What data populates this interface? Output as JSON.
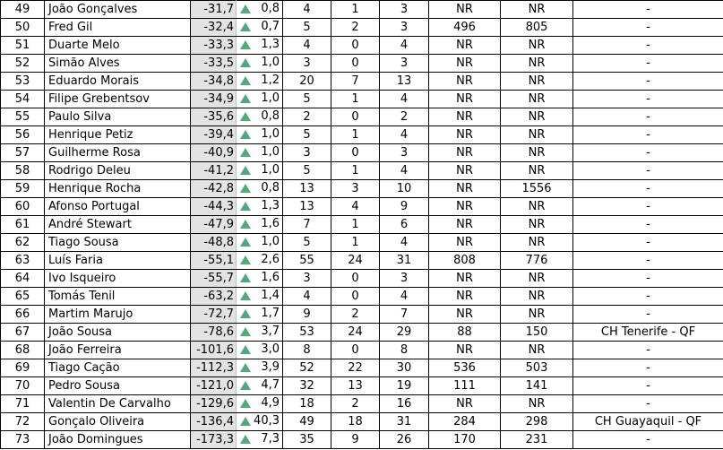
{
  "rows": [
    {
      "rank": "49",
      "name": "João Gonçalves",
      "score": "-31,7",
      "ratio": "0,8",
      "a": "4",
      "b": "1",
      "c": "3",
      "d": "NR",
      "e": "NR",
      "note": "-"
    },
    {
      "rank": "50",
      "name": "Fred Gil",
      "score": "-32,4",
      "ratio": "0,7",
      "a": "5",
      "b": "2",
      "c": "3",
      "d": "496",
      "e": "805",
      "note": "-"
    },
    {
      "rank": "51",
      "name": "Duarte Melo",
      "score": "-33,3",
      "ratio": "1,3",
      "a": "4",
      "b": "0",
      "c": "4",
      "d": "NR",
      "e": "NR",
      "note": "-"
    },
    {
      "rank": "52",
      "name": "Simão Alves",
      "score": "-33,5",
      "ratio": "1,0",
      "a": "3",
      "b": "0",
      "c": "3",
      "d": "NR",
      "e": "NR",
      "note": "-"
    },
    {
      "rank": "53",
      "name": "Eduardo Morais",
      "score": "-34,8",
      "ratio": "1,2",
      "a": "20",
      "b": "7",
      "c": "13",
      "d": "NR",
      "e": "NR",
      "note": "-"
    },
    {
      "rank": "54",
      "name": "Filipe Grebentsov",
      "score": "-34,9",
      "ratio": "1,0",
      "a": "5",
      "b": "1",
      "c": "4",
      "d": "NR",
      "e": "NR",
      "note": "-"
    },
    {
      "rank": "55",
      "name": "Paulo Silva",
      "score": "-35,6",
      "ratio": "0,8",
      "a": "2",
      "b": "0",
      "c": "2",
      "d": "NR",
      "e": "NR",
      "note": "-"
    },
    {
      "rank": "56",
      "name": "Henrique Petiz",
      "score": "-39,4",
      "ratio": "1,0",
      "a": "5",
      "b": "1",
      "c": "4",
      "d": "NR",
      "e": "NR",
      "note": "-"
    },
    {
      "rank": "57",
      "name": "Guilherme Rosa",
      "score": "-40,9",
      "ratio": "1,0",
      "a": "3",
      "b": "0",
      "c": "3",
      "d": "NR",
      "e": "NR",
      "note": "-"
    },
    {
      "rank": "58",
      "name": "Rodrigo Deleu",
      "score": "-41,2",
      "ratio": "1,0",
      "a": "5",
      "b": "1",
      "c": "4",
      "d": "NR",
      "e": "NR",
      "note": "-"
    },
    {
      "rank": "59",
      "name": "Henrique Rocha",
      "score": "-42,8",
      "ratio": "0,8",
      "a": "13",
      "b": "3",
      "c": "10",
      "d": "NR",
      "e": "1556",
      "note": "-"
    },
    {
      "rank": "60",
      "name": "Afonso Portugal",
      "score": "-44,3",
      "ratio": "1,3",
      "a": "13",
      "b": "4",
      "c": "9",
      "d": "NR",
      "e": "NR",
      "note": "-"
    },
    {
      "rank": "61",
      "name": "André Stewart",
      "score": "-47,9",
      "ratio": "1,6",
      "a": "7",
      "b": "1",
      "c": "6",
      "d": "NR",
      "e": "NR",
      "note": "-"
    },
    {
      "rank": "62",
      "name": "Tiago Sousa",
      "score": "-48,8",
      "ratio": "1,0",
      "a": "5",
      "b": "1",
      "c": "4",
      "d": "NR",
      "e": "NR",
      "note": "-"
    },
    {
      "rank": "63",
      "name": "Luís Faria",
      "score": "-55,1",
      "ratio": "2,6",
      "a": "55",
      "b": "24",
      "c": "31",
      "d": "808",
      "e": "776",
      "note": "-"
    },
    {
      "rank": "64",
      "name": "Ivo Isqueiro",
      "score": "-55,7",
      "ratio": "1,6",
      "a": "3",
      "b": "0",
      "c": "3",
      "d": "NR",
      "e": "NR",
      "note": "-"
    },
    {
      "rank": "65",
      "name": "Tomás Tenil",
      "score": "-63,2",
      "ratio": "1,4",
      "a": "4",
      "b": "0",
      "c": "4",
      "d": "NR",
      "e": "NR",
      "note": "-"
    },
    {
      "rank": "66",
      "name": "Martim Marujo",
      "score": "-72,7",
      "ratio": "1,7",
      "a": "9",
      "b": "2",
      "c": "7",
      "d": "NR",
      "e": "NR",
      "note": "-"
    },
    {
      "rank": "67",
      "name": "João Sousa",
      "score": "-78,6",
      "ratio": "3,7",
      "a": "53",
      "b": "24",
      "c": "29",
      "d": "88",
      "e": "150",
      "note": "CH Tenerife - QF"
    },
    {
      "rank": "68",
      "name": "João Ferreira",
      "score": "-101,6",
      "ratio": "3,0",
      "a": "8",
      "b": "0",
      "c": "8",
      "d": "NR",
      "e": "NR",
      "note": "-"
    },
    {
      "rank": "69",
      "name": "Tiago Cação",
      "score": "-112,3",
      "ratio": "3,9",
      "a": "52",
      "b": "22",
      "c": "30",
      "d": "536",
      "e": "503",
      "note": "-"
    },
    {
      "rank": "70",
      "name": "Pedro Sousa",
      "score": "-121,0",
      "ratio": "4,7",
      "a": "32",
      "b": "13",
      "c": "19",
      "d": "111",
      "e": "141",
      "note": "-"
    },
    {
      "rank": "71",
      "name": "Valentin De Carvalho",
      "score": "-129,6",
      "ratio": "4,9",
      "a": "18",
      "b": "2",
      "c": "16",
      "d": "NR",
      "e": "NR",
      "note": "-"
    },
    {
      "rank": "72",
      "name": "Gonçalo Oliveira",
      "score": "-136,4",
      "ratio": "40,3",
      "a": "49",
      "b": "18",
      "c": "31",
      "d": "284",
      "e": "298",
      "note": "CH Guayaquil - QF"
    },
    {
      "rank": "73",
      "name": "João Domingues",
      "score": "-173,3",
      "ratio": "7,3",
      "a": "35",
      "b": "9",
      "c": "26",
      "d": "170",
      "e": "231",
      "note": "-"
    }
  ],
  "colors": {
    "score_bg": "#e3e3e3",
    "arrow": "#53a77a"
  },
  "icons": {
    "trend": "triangle-up-icon"
  }
}
